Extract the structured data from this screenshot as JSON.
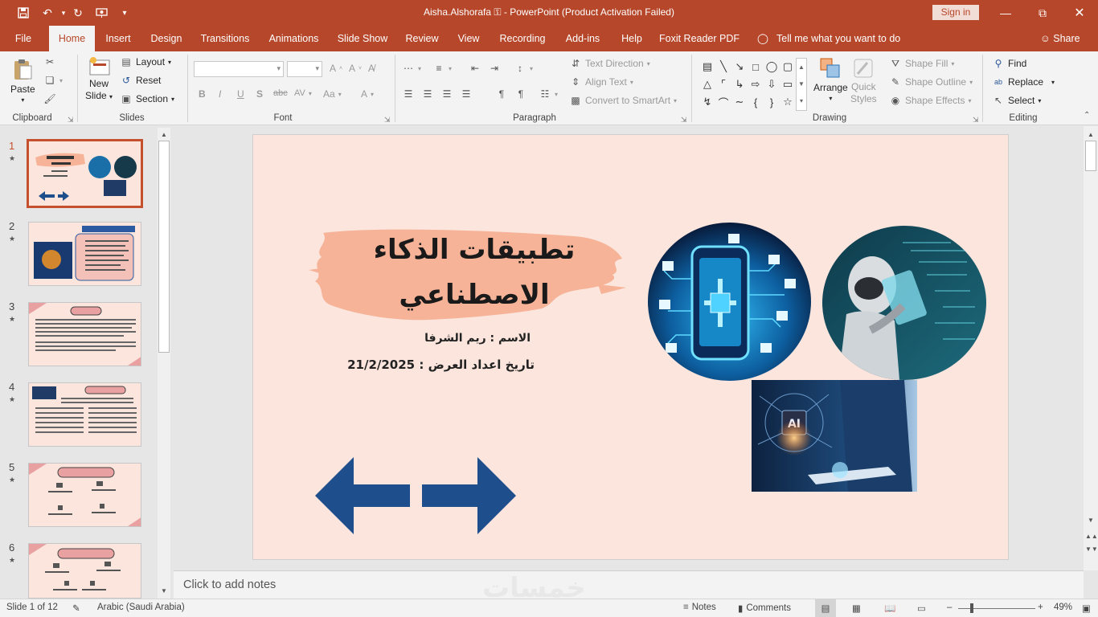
{
  "titlebar": {
    "title": "Aisha.Alshorafa  ⚿  -  PowerPoint (Product Activation Failed)",
    "signin": "Sign in",
    "quick_access": [
      "save-icon",
      "undo-icon",
      "redo-icon",
      "present-icon",
      "customize-icon"
    ]
  },
  "tabs": [
    "File",
    "Home",
    "Insert",
    "Design",
    "Transitions",
    "Animations",
    "Slide Show",
    "Review",
    "View",
    "Recording",
    "Add-ins",
    "Help",
    "Foxit Reader PDF"
  ],
  "active_tab": "Home",
  "tell_me": "Tell me what you want to do",
  "share": "Share",
  "ribbon": {
    "clipboard": {
      "label": "Clipboard",
      "paste": "Paste"
    },
    "slides": {
      "label": "Slides",
      "new_slide": "New",
      "new_slide2": "Slide",
      "layout": "Layout",
      "reset": "Reset",
      "section": "Section"
    },
    "font": {
      "label": "Font",
      "bold": "B",
      "italic": "I",
      "underline": "U",
      "shadow": "S",
      "strike": "abc",
      "spacing": "AV",
      "case": "Aa",
      "color": "A"
    },
    "paragraph": {
      "label": "Paragraph",
      "text_direction": "Text Direction",
      "align_text": "Align Text",
      "smartart": "Convert to SmartArt"
    },
    "drawing": {
      "label": "Drawing",
      "arrange": "Arrange",
      "quick_styles": "Quick",
      "quick_styles2": "Styles",
      "shape_fill": "Shape Fill",
      "shape_outline": "Shape Outline",
      "shape_effects": "Shape Effects"
    },
    "editing": {
      "label": "Editing",
      "find": "Find",
      "replace": "Replace",
      "select": "Select"
    }
  },
  "thumbnails": [
    {
      "num": "1",
      "active": true
    },
    {
      "num": "2",
      "active": false
    },
    {
      "num": "3",
      "active": false
    },
    {
      "num": "4",
      "active": false
    },
    {
      "num": "5",
      "active": false
    },
    {
      "num": "6",
      "active": false
    }
  ],
  "slide": {
    "title_line1": "تطبيقات الذكاء",
    "title_line2": "الاصطناعي",
    "name": "الاسم : ريم الشرفا",
    "date": "تاريخ اعداد العرض :  21/2/2025",
    "image_label": "AI"
  },
  "notes_placeholder": "Click to add notes",
  "watermark": "خمسات",
  "status": {
    "slide_info": "Slide 1 of 12",
    "language": "Arabic (Saudi Arabia)",
    "notes": "Notes",
    "comments": "Comments",
    "zoom": "49%"
  },
  "colors": {
    "accent": "#b7472a",
    "slide_bg": "#fbe5dd",
    "arrow": "#1f4e8c",
    "brush": "#f6b397"
  }
}
